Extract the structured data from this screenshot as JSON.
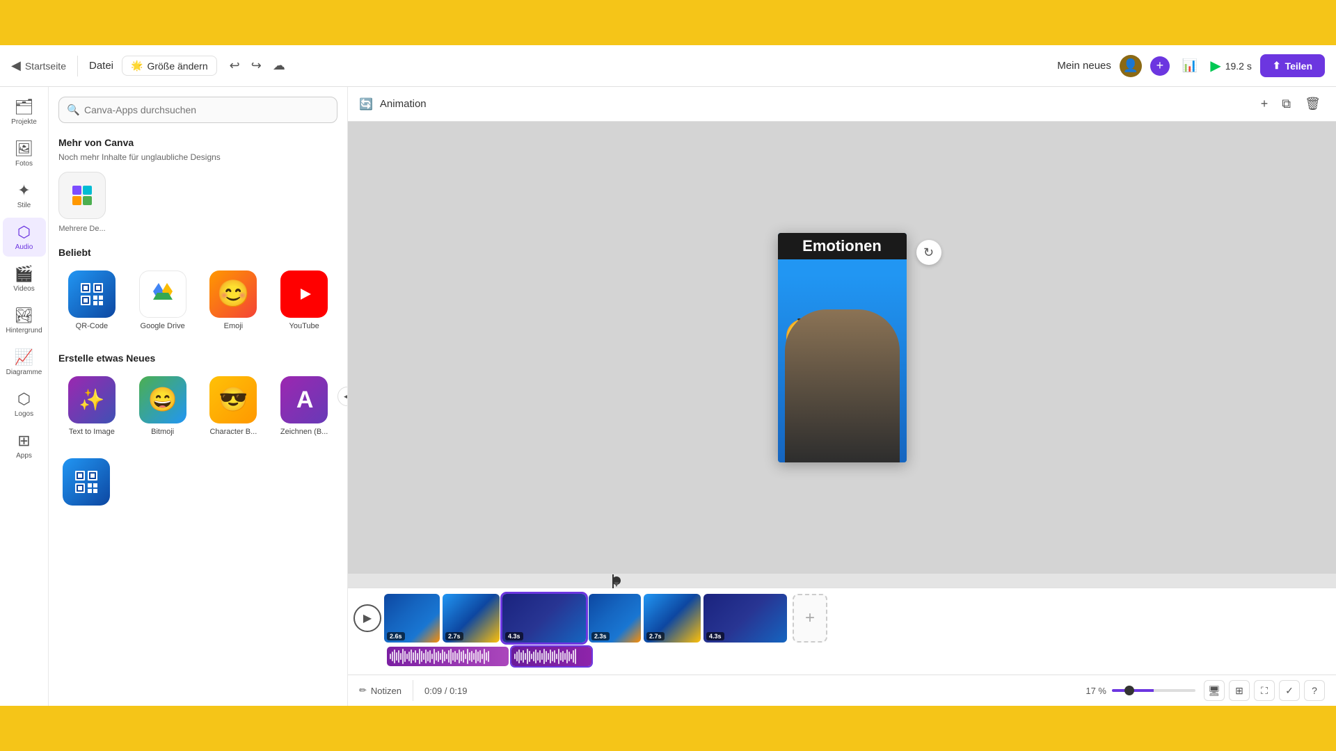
{
  "toolbar": {
    "back_label": "Startseite",
    "datei_label": "Datei",
    "groesse_label": "Größe ändern",
    "project_name": "Mein neues",
    "play_time": "19.2 s",
    "share_label": "Teilen"
  },
  "sidebar": {
    "items": [
      {
        "id": "projekte",
        "label": "Projekte",
        "icon": "🗂"
      },
      {
        "id": "fotos",
        "label": "Fotos",
        "icon": "🖼"
      },
      {
        "id": "stile",
        "label": "Stile",
        "icon": "🎨"
      },
      {
        "id": "audio",
        "label": "Audio",
        "icon": "🎵",
        "active": true
      },
      {
        "id": "videos",
        "label": "Videos",
        "icon": "🎬"
      },
      {
        "id": "hintergrund",
        "label": "Hintergrund",
        "icon": "🏞"
      },
      {
        "id": "diagramme",
        "label": "Diagramme",
        "icon": "📊"
      },
      {
        "id": "logos",
        "label": "Logos",
        "icon": "🔷"
      },
      {
        "id": "apps",
        "label": "Apps",
        "icon": "⊞"
      }
    ]
  },
  "apps_panel": {
    "search_placeholder": "Canva-Apps durchsuchen",
    "mehr_von_canva": {
      "title": "Mehr von Canva",
      "subtitle": "Noch mehr Inhalte für unglaubliche Designs",
      "icon_label": "Mehrere De..."
    },
    "popular": {
      "title": "Beliebt",
      "items": [
        {
          "id": "qr-code",
          "label": "QR-Code",
          "icon_type": "qr"
        },
        {
          "id": "google-drive",
          "label": "Google Drive",
          "icon_type": "gdrive"
        },
        {
          "id": "emoji",
          "label": "Emoji",
          "icon_type": "emoji"
        },
        {
          "id": "youtube",
          "label": "YouTube",
          "icon_type": "youtube"
        }
      ]
    },
    "create_new": {
      "title": "Erstelle etwas Neues",
      "items": [
        {
          "id": "text-to-image",
          "label": "Text to Image",
          "icon_type": "text-img"
        },
        {
          "id": "bitmoji",
          "label": "Bitmoji",
          "icon_type": "bitmoji"
        },
        {
          "id": "character-b",
          "label": "Character B...",
          "icon_type": "character"
        },
        {
          "id": "zeichnen-b",
          "label": "Zeichnen (B...",
          "icon_type": "zeichnen"
        }
      ]
    },
    "qr_bottom": {
      "id": "qr-code-2",
      "icon_type": "qr2"
    }
  },
  "canvas": {
    "header_label": "Animation",
    "video": {
      "title": "Emotionen",
      "emoji": "🤔"
    }
  },
  "timeline": {
    "clips": [
      {
        "id": "c1",
        "duration": "2.6s",
        "active": false
      },
      {
        "id": "c2",
        "duration": "2.7s",
        "active": false
      },
      {
        "id": "c3",
        "duration": "4.3s",
        "active": true
      },
      {
        "id": "c4",
        "duration": "2.3s",
        "active": false
      },
      {
        "id": "c5",
        "duration": "2.7s",
        "active": false
      },
      {
        "id": "c6",
        "duration": "4.3s",
        "active": false
      }
    ]
  },
  "statusbar": {
    "notes_label": "Notizen",
    "time_current": "0:09",
    "time_total": "0:19",
    "zoom_percent": "17 %"
  }
}
